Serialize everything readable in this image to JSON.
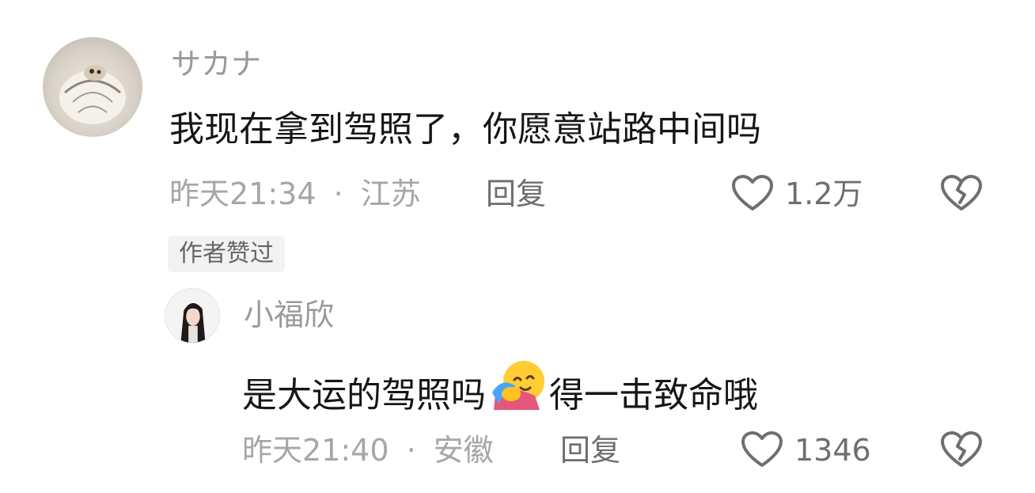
{
  "comment": {
    "username": "サカナ",
    "content": "我现在拿到驾照了，你愿意站路中间吗",
    "time": "昨天21:34",
    "separator": "·",
    "location": "江苏",
    "reply_label": "回复",
    "like_count": "1.2万",
    "author_tag": "作者赞过"
  },
  "reply": {
    "username": "小福欣",
    "content_before_emoji": "是大运的驾照吗",
    "emoji": "hugging-face-emoji",
    "content_after_emoji": "得一击致命哦",
    "time": "昨天21:40",
    "separator": "·",
    "location": "安徽",
    "reply_label": "回复",
    "like_count": "1346"
  },
  "icons": {
    "like": "heart-outline-icon",
    "dislike": "broken-heart-icon"
  },
  "colors": {
    "text_primary": "#161616",
    "text_secondary": "#a6a6a6",
    "action_text": "#6e6e6e",
    "tag_background": "#f2f2f2"
  }
}
